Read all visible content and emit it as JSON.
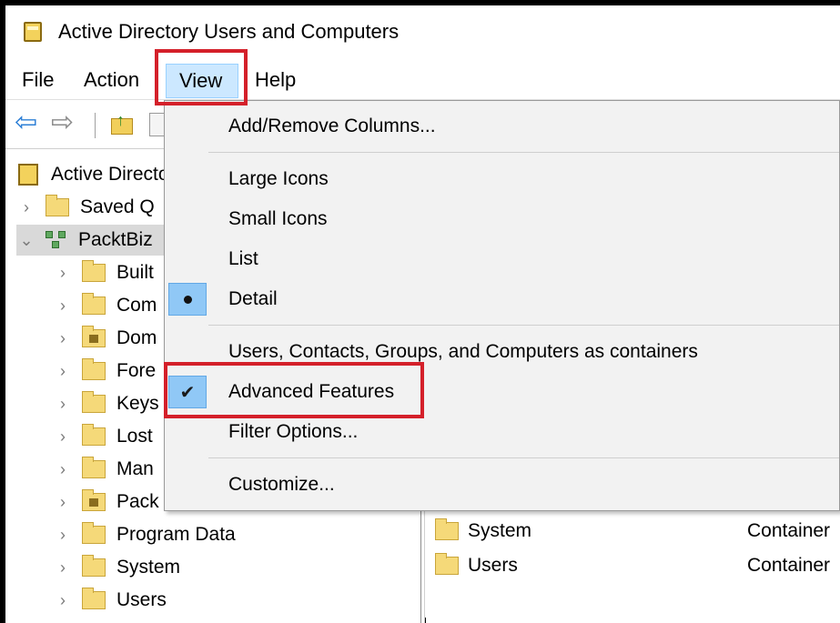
{
  "window": {
    "title": "Active Directory Users and Computers",
    "icon": "ad-console-icon"
  },
  "menubar": {
    "items": [
      {
        "label": "File"
      },
      {
        "label": "Action"
      },
      {
        "label": "View",
        "active": true
      },
      {
        "label": "Help"
      }
    ]
  },
  "toolbar": {
    "icons": [
      "back-arrow-icon",
      "forward-arrow-icon",
      "up-folder-icon",
      "properties-page-icon"
    ]
  },
  "tree": {
    "root": "Active Directo",
    "saved_queries": "Saved Q",
    "domain": "PacktBiz",
    "children": [
      {
        "label": "Built",
        "icon": "folder-icon"
      },
      {
        "label": "Com",
        "icon": "folder-icon"
      },
      {
        "label": "Dom",
        "icon": "ou-folder-icon"
      },
      {
        "label": "Fore",
        "icon": "folder-icon"
      },
      {
        "label": "Keys",
        "icon": "folder-icon"
      },
      {
        "label": "Lost",
        "icon": "folder-icon"
      },
      {
        "label": "Man",
        "icon": "folder-icon"
      },
      {
        "label": "Pack",
        "icon": "ou-folder-icon"
      },
      {
        "label": "Program Data",
        "icon": "folder-icon"
      },
      {
        "label": "System",
        "icon": "folder-icon"
      },
      {
        "label": "Users",
        "icon": "folder-icon"
      }
    ]
  },
  "list": {
    "rows": [
      {
        "name": "System",
        "type": "Container"
      },
      {
        "name": "Users",
        "type": "Container"
      }
    ]
  },
  "view_menu": {
    "add_remove_columns": "Add/Remove Columns...",
    "large_icons": "Large Icons",
    "small_icons": "Small Icons",
    "list": "List",
    "detail": "Detail",
    "users_as_containers": "Users, Contacts, Groups, and Computers as containers",
    "advanced_features": "Advanced Features",
    "filter_options": "Filter Options...",
    "customize": "Customize...",
    "selected_view": "Detail",
    "advanced_features_checked": true
  },
  "colors": {
    "highlight_box": "#d4202a",
    "menu_active": "#cce8ff",
    "check_gutter": "#90c8f6"
  }
}
